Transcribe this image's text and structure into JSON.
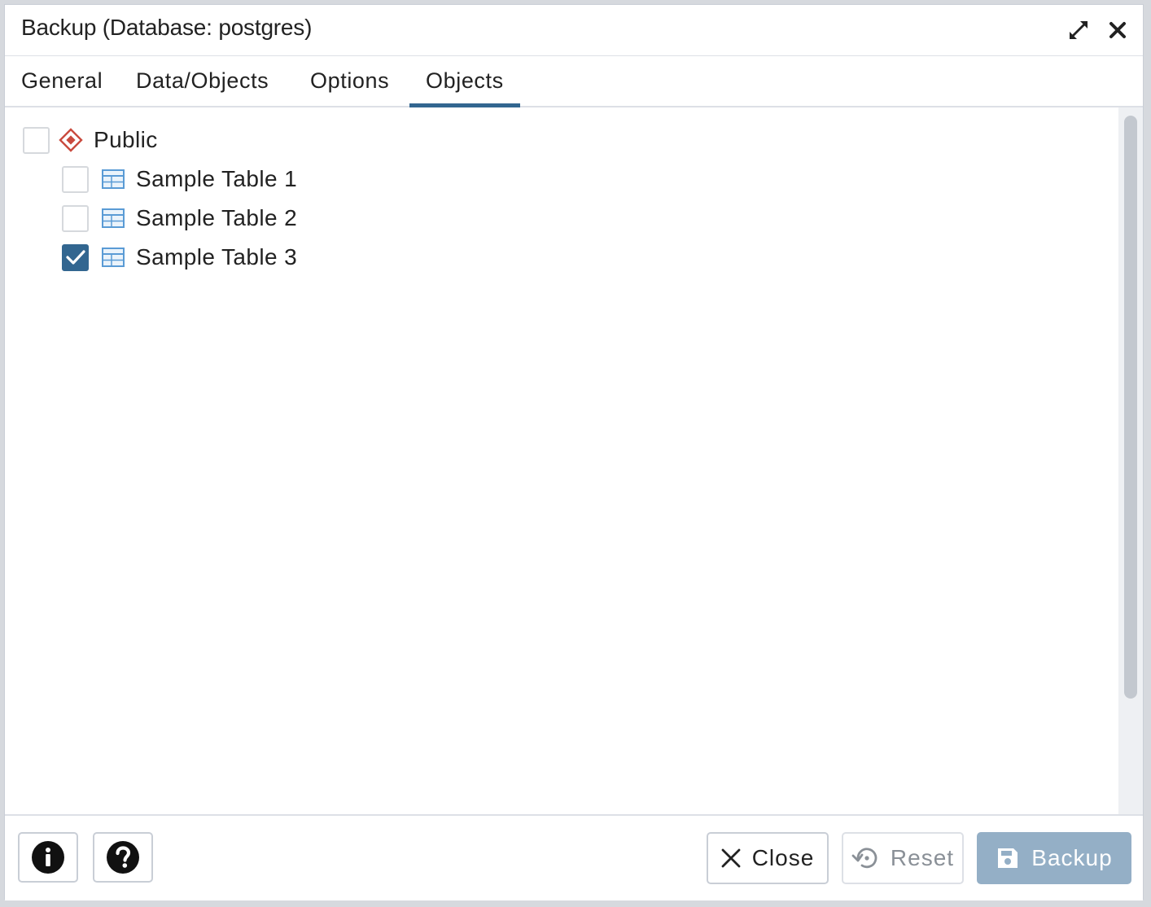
{
  "dialog": {
    "title": "Backup (Database: postgres)"
  },
  "tabs": [
    {
      "label": "General",
      "active": false
    },
    {
      "label": "Data/Objects",
      "active": false
    },
    {
      "label": "Options",
      "active": false
    },
    {
      "label": "Objects",
      "active": true
    }
  ],
  "tree": {
    "schema": {
      "label": "Public",
      "checked": false,
      "icon": "schema-icon"
    },
    "tables": [
      {
        "label": "Sample Table 1",
        "checked": false,
        "icon": "table-icon"
      },
      {
        "label": "Sample Table 2",
        "checked": false,
        "icon": "table-icon"
      },
      {
        "label": "Sample Table 3",
        "checked": true,
        "icon": "table-icon"
      }
    ]
  },
  "footer": {
    "info_icon": "info-icon",
    "help_icon": "help-icon",
    "close_label": "Close",
    "reset_label": "Reset",
    "backup_label": "Backup"
  },
  "colors": {
    "accent": "#326690",
    "primary_disabled": "#94afc6",
    "schema_icon": "#c94a3e",
    "table_icon": "#5a9bd5"
  }
}
